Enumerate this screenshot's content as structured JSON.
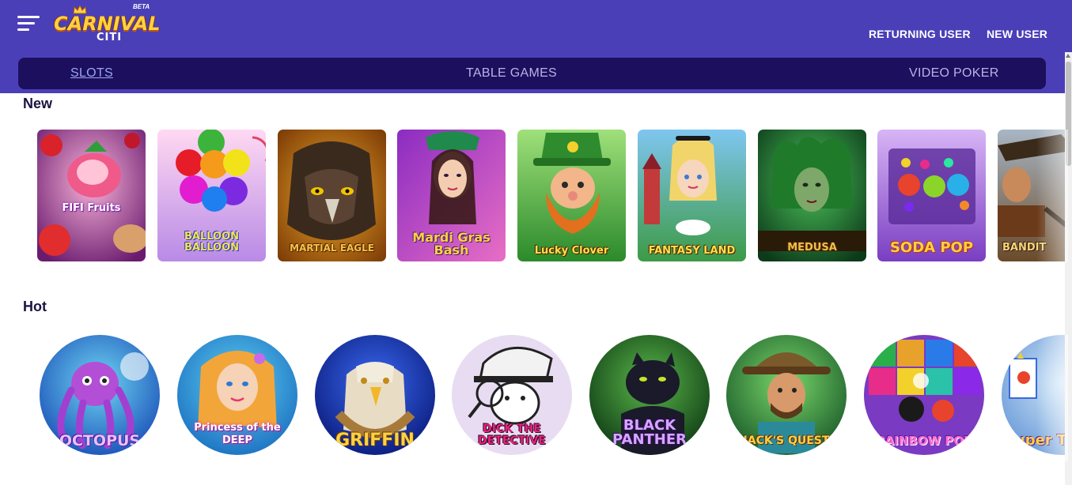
{
  "header": {
    "logo": {
      "line1": "CARNIVAL",
      "line2": "CITI",
      "badge": "BETA"
    },
    "returning_user": "RETURNING USER",
    "new_user": "NEW USER",
    "background_color": "#4b3fb8"
  },
  "tabs": [
    {
      "label": "SLOTS",
      "active": true
    },
    {
      "label": "TABLE GAMES",
      "active": false
    },
    {
      "label": "VIDEO POKER",
      "active": false
    }
  ],
  "sections": {
    "new": {
      "title": "New",
      "games": [
        {
          "label": "FIFI Fruits"
        },
        {
          "label": "BALLOON BALLOON"
        },
        {
          "label": "MARTIAL EAGLE"
        },
        {
          "label": "Mardi Gras Bash"
        },
        {
          "label": "Lucky Clover"
        },
        {
          "label": "FANTASY LAND"
        },
        {
          "label": "MEDUSA"
        },
        {
          "label": "SODA POP"
        },
        {
          "label": "BANDIT"
        }
      ]
    },
    "hot": {
      "title": "Hot",
      "games": [
        {
          "label": "OCTOPUS"
        },
        {
          "label": "Princess of the DEEP"
        },
        {
          "label": "GRIFFIN"
        },
        {
          "label": "DICK THE DETECTIVE"
        },
        {
          "label": "BLACK PANTHER"
        },
        {
          "label": "JACK'S QUEST"
        },
        {
          "label": "RAINBOW POP"
        },
        {
          "label": "Super Time"
        }
      ]
    }
  },
  "icons": {
    "menu": "hamburger-menu-icon"
  }
}
